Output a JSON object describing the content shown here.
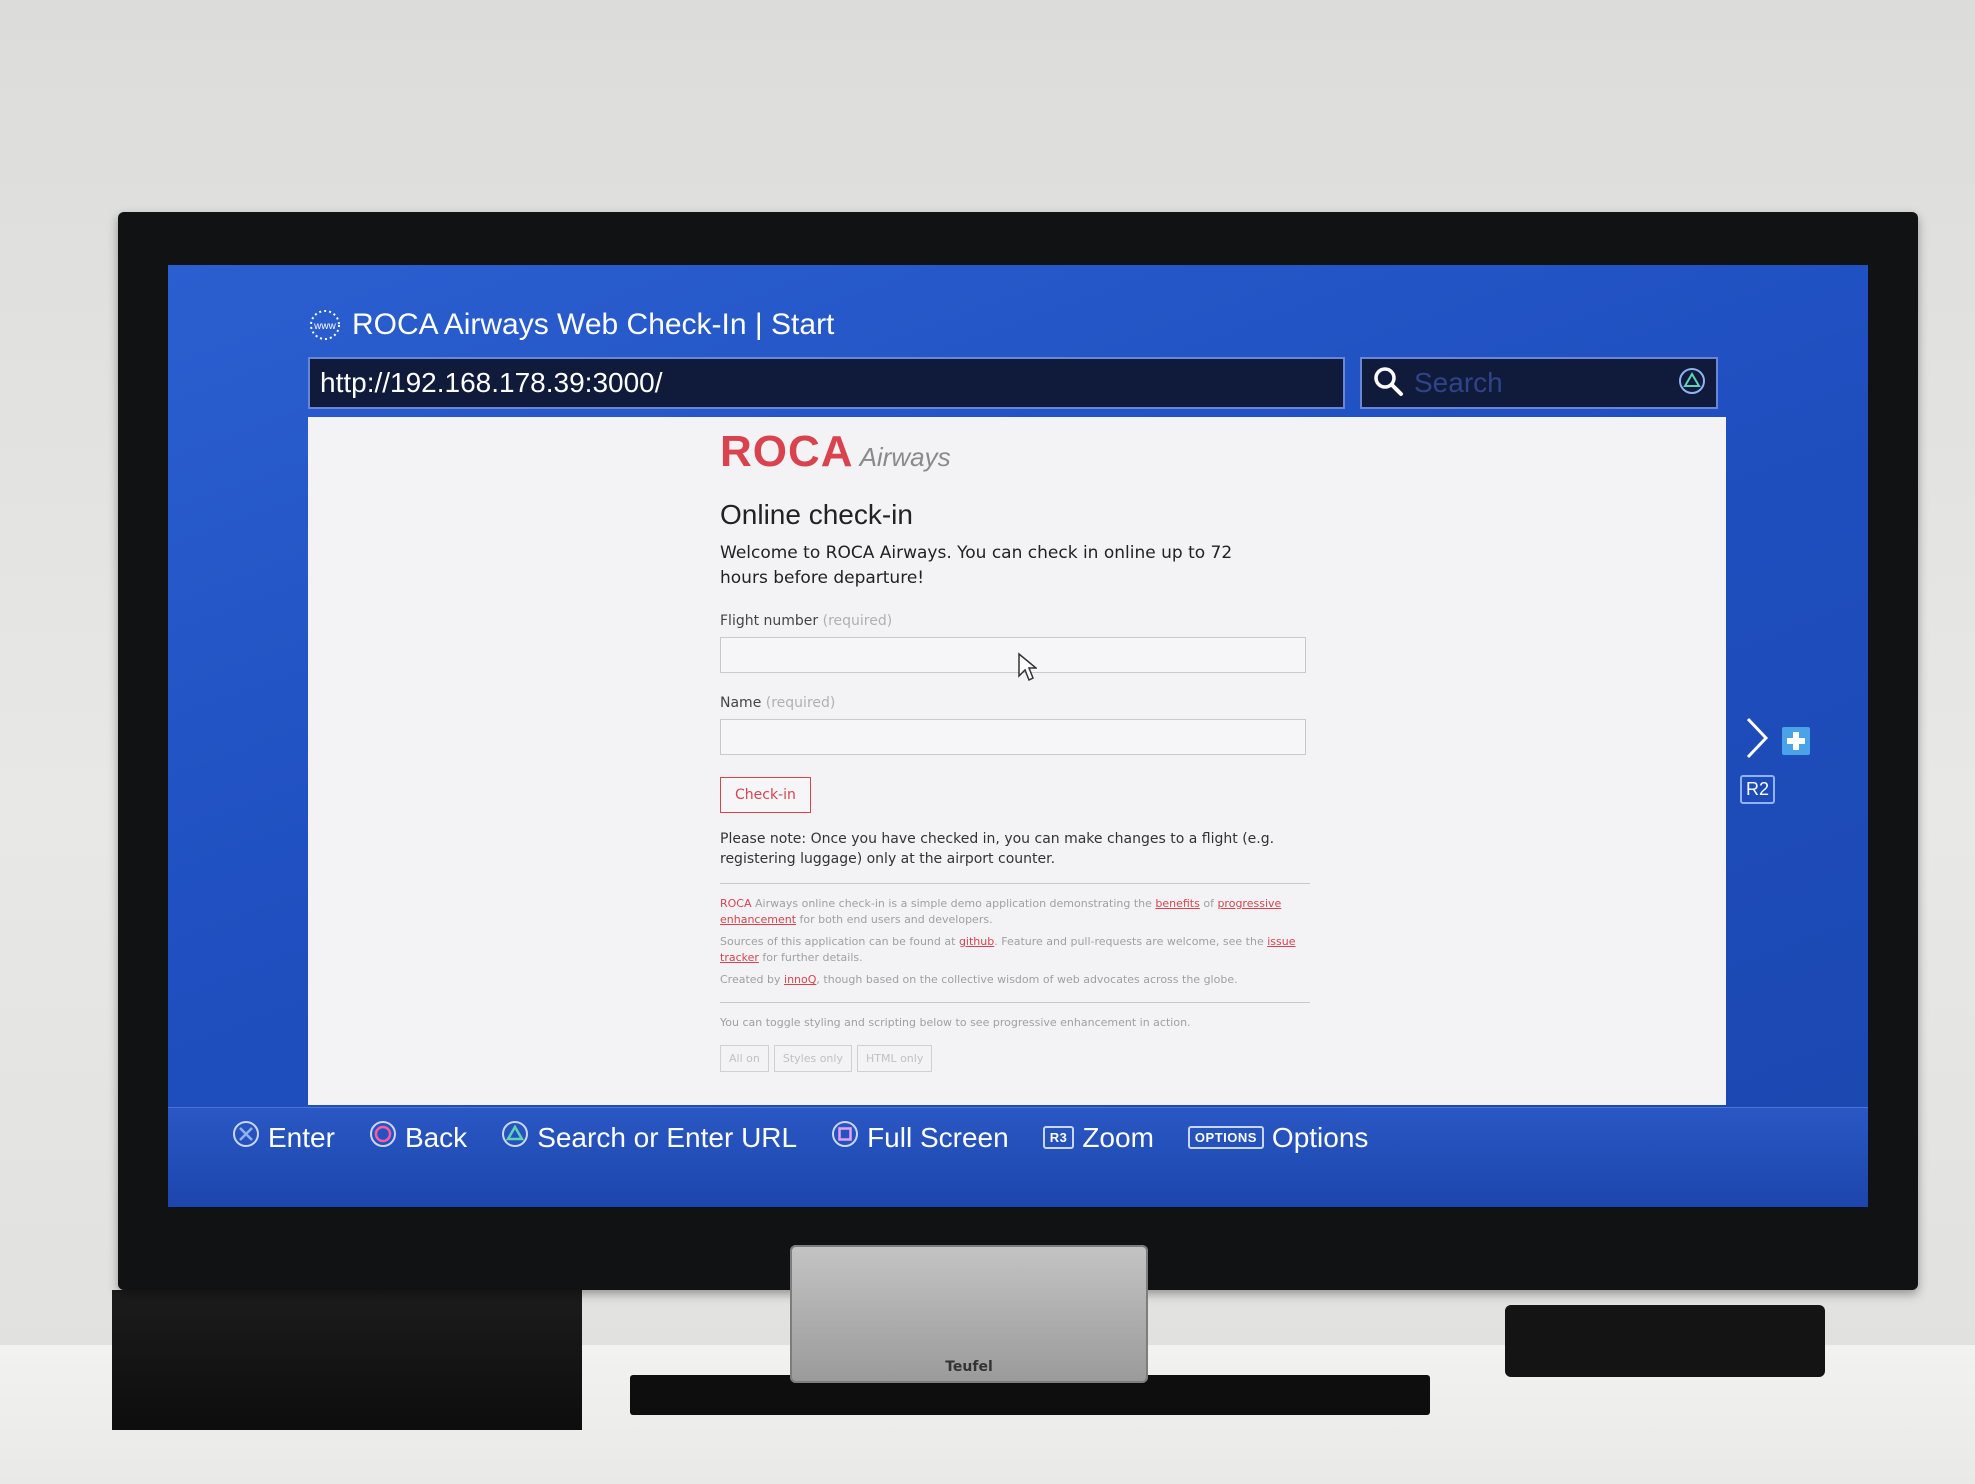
{
  "browser": {
    "title": "ROCA Airways Web Check-In | Start",
    "url": "http://192.168.178.39:3000/",
    "search_placeholder": "Search",
    "www_icon_label": "www"
  },
  "page": {
    "logo_main": "ROCA",
    "logo_sub": "Airways",
    "heading": "Online check-in",
    "intro": "Welcome to ROCA Airways. You can check in online up to 72 hours before departure!",
    "flight_label": "Flight number",
    "name_label": "Name",
    "required": "(required)",
    "checkin_button": "Check-in",
    "note": "Please note: Once you have checked in, you can make changes to a flight (e.g. registering luggage) only at the airport counter.",
    "fine_1a": "ROCA",
    "fine_1b": " Airways online check-in is a simple demo application demonstrating the ",
    "fine_1_link1": "benefits",
    "fine_1c": " of ",
    "fine_1_link2": "progressive enhancement",
    "fine_1d": " for both end users and developers.",
    "fine_2a": "Sources of this application can be found at ",
    "fine_2_link1": "github",
    "fine_2b": ". Feature and pull-requests are welcome, see the ",
    "fine_2_link2": "issue tracker",
    "fine_2c": " for further details.",
    "fine_3a": "Created by ",
    "fine_3_link": "innoQ",
    "fine_3b": ", though based on the collective wisdom of web advocates across the globe.",
    "toggle_text": "You can toggle styling and scripting below to see progressive enhancement in action.",
    "toggles": [
      "All on",
      "Styles only",
      "HTML only"
    ]
  },
  "side_nav": {
    "r2_label": "R2"
  },
  "bottom_bar": {
    "enter": "Enter",
    "back": "Back",
    "search": "Search or Enter URL",
    "fullscreen": "Full Screen",
    "r3_badge": "R3",
    "zoom": "Zoom",
    "options_badge": "OPTIONS",
    "options": "Options"
  },
  "hardware": {
    "speaker_brand": "Teufel"
  },
  "colors": {
    "accent_red": "#d9434e",
    "screen_blue": "#2358c8"
  }
}
